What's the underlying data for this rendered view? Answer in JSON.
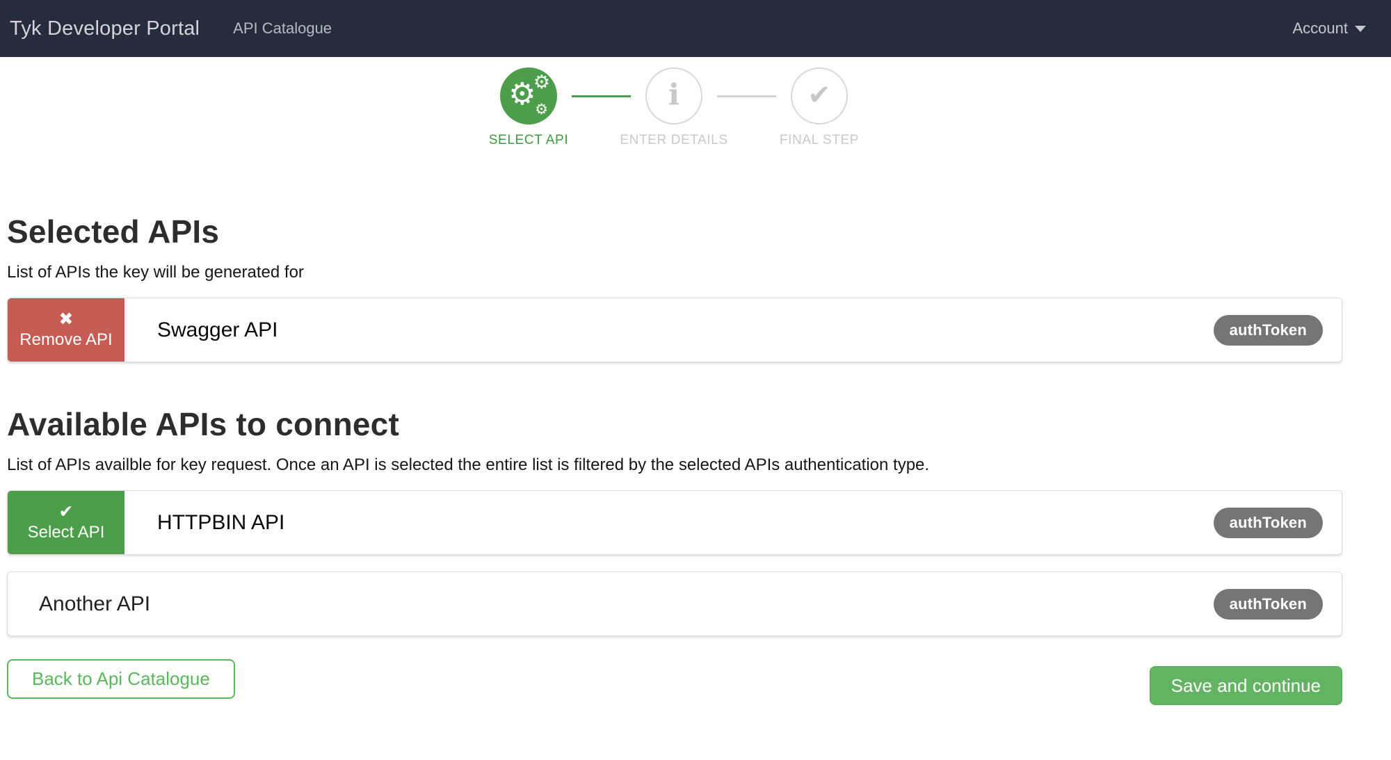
{
  "navbar": {
    "brand": "Tyk Developer Portal",
    "catalogue_link": "API Catalogue",
    "account_label": "Account"
  },
  "stepper": {
    "steps": [
      {
        "label": "SELECT API",
        "icon": "cogs-icon",
        "state": "active"
      },
      {
        "label": "ENTER DETAILS",
        "icon": "info-icon",
        "state": "upcoming"
      },
      {
        "label": "FINAL STEP",
        "icon": "check-icon",
        "state": "upcoming"
      }
    ]
  },
  "icons": {
    "gear": "⚙",
    "info": "i",
    "check": "✔",
    "cross": "✖"
  },
  "selected_section": {
    "title": "Selected APIs",
    "subtitle": "List of APIs the key will be generated for",
    "apis": [
      {
        "name": "Swagger API",
        "auth_type": "authToken",
        "action_label": "Remove API"
      }
    ]
  },
  "available_section": {
    "title": "Available APIs to connect",
    "subtitle": "List of APIs availble for key request. Once an API is selected the entire list is filtered by the selected APIs authentication type.",
    "apis": [
      {
        "name": "HTTPBIN API",
        "auth_type": "authToken",
        "action_label": "Select API"
      },
      {
        "name": "Another API",
        "auth_type": "authToken",
        "action_label": null
      }
    ]
  },
  "footer": {
    "back_label": "Back to Api Catalogue",
    "save_label": "Save and continue"
  },
  "colors": {
    "navbar_bg": "#272b3d",
    "accent_green": "#4d9e4a",
    "button_green": "#62b462",
    "outline_green": "#5cb75c",
    "remove_red": "#c65d54",
    "badge_gray": "#757575",
    "inactive_gray": "#c8c8c8"
  }
}
